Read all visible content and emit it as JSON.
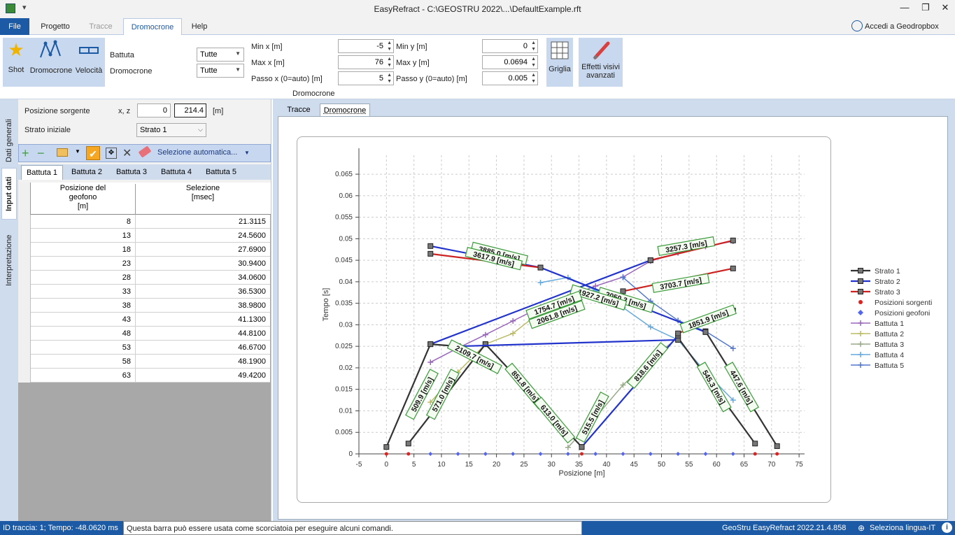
{
  "window": {
    "title": "EasyRefract - C:\\GEOSTRU 2022\\...\\DefaultExample.rft"
  },
  "menu": {
    "file": "File",
    "tabs": [
      "Progetto",
      "Tracce",
      "Dromocrone",
      "Help"
    ],
    "account": "Accedi a Geodropbox"
  },
  "ribbon": {
    "shot": "Shot",
    "dromocrone": "Dromocrone",
    "velocita": "Velocità",
    "battuta_label": "Battuta",
    "battuta_value": "Tutte",
    "dromocrone_label": "Dromocrone",
    "dromocrone_value": "Tutte",
    "min_x_label": "Min x [m]",
    "min_x": "-5",
    "max_x_label": "Max x [m]",
    "max_x": "76",
    "passo_x_label": "Passo x (0=auto) [m]",
    "passo_x": "5",
    "min_y_label": "Min y [m]",
    "min_y": "0",
    "max_y_label": "Max y [m]",
    "max_y": "0.0694",
    "passo_y_label": "Passo y (0=auto) [m]",
    "passo_y": "0.005",
    "group_label": "Dromocrone",
    "griglia": "Griglia",
    "effetti1": "Effetti visivi",
    "effetti2": "avanzati"
  },
  "side_tabs": [
    "Dati generali",
    "Input dati",
    "Interpretazione"
  ],
  "input": {
    "posizione_label": "Posizione sorgente",
    "xz_label": "x, z",
    "x_value": "0",
    "z_value": "214.4",
    "unit": "[m]",
    "strato_label": "Strato iniziale",
    "strato_value": "Strato 1",
    "auto_sel": "Selezione automatica...",
    "battute": [
      "Battuta 1",
      "Battuta 2",
      "Battuta 3",
      "Battuta 4",
      "Battuta 5"
    ],
    "col1_l1": "Posizione del",
    "col1_l2": "geofono",
    "col1_l3": "[m]",
    "col2_l1": "Selezione",
    "col2_l2": "[msec]",
    "rows": [
      [
        "8",
        "21.3115"
      ],
      [
        "13",
        "24.5600"
      ],
      [
        "18",
        "27.6900"
      ],
      [
        "23",
        "30.9400"
      ],
      [
        "28",
        "34.0600"
      ],
      [
        "33",
        "36.5300"
      ],
      [
        "38",
        "38.9800"
      ],
      [
        "43",
        "41.1300"
      ],
      [
        "48",
        "44.8100"
      ],
      [
        "53",
        "46.6700"
      ],
      [
        "58",
        "48.1900"
      ],
      [
        "63",
        "49.4200"
      ]
    ]
  },
  "chart_tabs": [
    "Tracce",
    "Dromocrone"
  ],
  "chart_data": {
    "type": "line",
    "xlabel": "Posizione [m]",
    "ylabel": "Tempo [s]",
    "xlim": [
      -5,
      76
    ],
    "ylim": [
      0,
      0.0694
    ],
    "x_ticks": [
      "-5",
      "0",
      "5",
      "10",
      "15",
      "20",
      "25",
      "30",
      "35",
      "40",
      "45",
      "50",
      "55",
      "60",
      "65",
      "70",
      "75"
    ],
    "y_ticks": [
      "0",
      "0.005",
      "0.01",
      "0.015",
      "0.02",
      "0.025",
      "0.03",
      "0.035",
      "0.04",
      "0.045",
      "0.05",
      "0.055",
      "0.06",
      "0.065"
    ],
    "grid": true,
    "legend_position": "right",
    "legend": [
      {
        "name": "Strato 1",
        "color": "#333333",
        "marker": "square"
      },
      {
        "name": "Strato 2",
        "color": "#2233cc",
        "marker": "square"
      },
      {
        "name": "Strato 3",
        "color": "#cc2222",
        "marker": "square"
      },
      {
        "name": "Posizioni sorgenti",
        "color": "#dd2222",
        "marker": "star"
      },
      {
        "name": "Posizioni geofoni",
        "color": "#5566ee",
        "marker": "diamond"
      },
      {
        "name": "Battuta 1",
        "color": "#9966bb",
        "marker": "plus"
      },
      {
        "name": "Battuta 2",
        "color": "#bbbb66",
        "marker": "plus"
      },
      {
        "name": "Battuta 3",
        "color": "#99aa88",
        "marker": "plus"
      },
      {
        "name": "Battuta 4",
        "color": "#66aadd",
        "marker": "plus"
      },
      {
        "name": "Battuta 5",
        "color": "#5577cc",
        "marker": "plus"
      }
    ],
    "strato_series": [
      {
        "color": "#333333",
        "points": [
          [
            0,
            0.0016
          ],
          [
            8,
            0.0255
          ],
          [
            13,
            0.025
          ]
        ]
      },
      {
        "color": "#333333",
        "points": [
          [
            4,
            0.0024
          ],
          [
            18,
            0.0255
          ]
        ]
      },
      {
        "color": "#333333",
        "points": [
          [
            18,
            0.0255
          ],
          [
            35.5,
            0.0016
          ]
        ]
      },
      {
        "color": "#333333",
        "points": [
          [
            53,
            0.027
          ],
          [
            67,
            0.0024
          ]
        ]
      },
      {
        "color": "#333333",
        "points": [
          [
            58,
            0.0285
          ],
          [
            71,
            0.0018
          ]
        ]
      },
      {
        "color": "#2233cc",
        "points": [
          [
            8,
            0.0255
          ],
          [
            48,
            0.045
          ]
        ]
      },
      {
        "color": "#2233cc",
        "points": [
          [
            13,
            0.025
          ],
          [
            53,
            0.0265
          ]
        ]
      },
      {
        "color": "#2233cc",
        "points": [
          [
            35.5,
            0.0016
          ],
          [
            53,
            0.0275
          ]
        ]
      },
      {
        "color": "#2233cc",
        "points": [
          [
            8,
            0.0483
          ],
          [
            28,
            0.0433
          ],
          [
            58,
            0.0283
          ]
        ]
      },
      {
        "color": "#cc2222",
        "points": [
          [
            8,
            0.0465
          ],
          [
            28,
            0.0433
          ]
        ]
      },
      {
        "color": "#cc2222",
        "points": [
          [
            48,
            0.045
          ],
          [
            63,
            0.0496
          ]
        ]
      },
      {
        "color": "#cc2222",
        "points": [
          [
            43,
            0.0378
          ],
          [
            63,
            0.0431
          ]
        ]
      },
      {
        "color": "#cc2222",
        "points": [
          [
            53,
            0.028
          ],
          [
            63,
            0.0333
          ]
        ]
      }
    ],
    "battuta_series": [
      {
        "color": "#9966bb",
        "points": [
          [
            8,
            0.0213
          ],
          [
            13,
            0.0246
          ],
          [
            18,
            0.0277
          ],
          [
            23,
            0.0309
          ],
          [
            28,
            0.0341
          ],
          [
            33,
            0.0365
          ],
          [
            38,
            0.039
          ],
          [
            43,
            0.0411
          ],
          [
            48,
            0.0448
          ],
          [
            53,
            0.0467
          ],
          [
            58,
            0.0482
          ],
          [
            63,
            0.0494
          ]
        ]
      },
      {
        "color": "#bbbb66",
        "points": [
          [
            8,
            0.012
          ],
          [
            13,
            0.019
          ],
          [
            18,
            0.0255
          ],
          [
            23,
            0.028
          ],
          [
            28,
            0.033
          ],
          [
            33,
            0.0365
          ]
        ]
      },
      {
        "color": "#99aa88",
        "points": [
          [
            33,
            0.0015
          ],
          [
            38,
            0.0085
          ],
          [
            43,
            0.016
          ],
          [
            48,
            0.022
          ],
          [
            53,
            0.027
          ]
        ]
      },
      {
        "color": "#66aadd",
        "points": [
          [
            28,
            0.0398
          ],
          [
            33,
            0.041
          ],
          [
            38,
            0.038
          ],
          [
            43,
            0.034
          ],
          [
            48,
            0.0295
          ],
          [
            53,
            0.0265
          ],
          [
            58,
            0.019
          ],
          [
            63,
            0.0125
          ]
        ]
      },
      {
        "color": "#5577cc",
        "points": [
          [
            43,
            0.041
          ],
          [
            48,
            0.0355
          ],
          [
            53,
            0.031
          ],
          [
            58,
            0.0285
          ],
          [
            63,
            0.0245
          ]
        ]
      }
    ],
    "velocity_labels": [
      {
        "text": "3885.0 [m/s]",
        "x": 20.5,
        "y": 0.0465,
        "angle": 14
      },
      {
        "text": "3617.9 [m/s]",
        "x": 19.5,
        "y": 0.0453,
        "angle": 14
      },
      {
        "text": "3257.3 [m/s]",
        "x": 54.5,
        "y": 0.0482,
        "angle": -10
      },
      {
        "text": "3703.7 [m/s]",
        "x": 53.5,
        "y": 0.0396,
        "angle": -10
      },
      {
        "text": "2050.3 [m/s]",
        "x": 43.5,
        "y": 0.0357,
        "angle": 17
      },
      {
        "text": "1927.2 [m/s]",
        "x": 38.5,
        "y": 0.0363,
        "angle": 17
      },
      {
        "text": "1754.7 [m/s]",
        "x": 30.5,
        "y": 0.0345,
        "angle": -20
      },
      {
        "text": "2061.8 [m/s]",
        "x": 31.0,
        "y": 0.0323,
        "angle": -20
      },
      {
        "text": "1851.9 [m/s]",
        "x": 58.5,
        "y": 0.0313,
        "angle": -20
      },
      {
        "text": "2109.7 [m/s]",
        "x": 16.0,
        "y": 0.0225,
        "angle": 27
      },
      {
        "text": "509.9 [m/s]",
        "x": 6.5,
        "y": 0.0138,
        "angle": -62
      },
      {
        "text": "571.0 [m/s]",
        "x": 10.3,
        "y": 0.0138,
        "angle": -62
      },
      {
        "text": "851.8 [m/s]",
        "x": 25.2,
        "y": 0.0157,
        "angle": 50
      },
      {
        "text": "613.0 [m/s]",
        "x": 30.5,
        "y": 0.0078,
        "angle": 50
      },
      {
        "text": "515.5 [m/s]",
        "x": 37.5,
        "y": 0.0085,
        "angle": -62
      },
      {
        "text": "818.6 [m/s]",
        "x": 47.5,
        "y": 0.0205,
        "angle": -50
      },
      {
        "text": "545.3 [m/s]",
        "x": 59.5,
        "y": 0.0155,
        "angle": 60
      },
      {
        "text": "447.6 [m/s]",
        "x": 64.5,
        "y": 0.0155,
        "angle": 60
      }
    ],
    "source_positions": [
      0,
      4,
      35.5,
      67,
      71
    ],
    "geophone_positions": [
      8,
      13,
      18,
      23,
      28,
      33,
      38,
      43,
      48,
      53,
      58,
      63
    ]
  },
  "status": {
    "left": "ID traccia: 1; Tempo: -48.0620 ms",
    "hint": "Questa barra può essere usata come scorciatoia per eseguire alcuni comandi.",
    "version": "GeoStru EasyRefract 2022.21.4.858",
    "language": "Seleziona lingua-IT"
  }
}
